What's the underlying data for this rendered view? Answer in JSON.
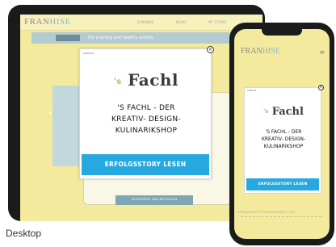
{
  "caption": "Desktop",
  "tablet": {
    "logo_a": "FRAN",
    "logo_b": "HISE",
    "menu": [
      "ERKUNDE",
      "NEWS",
      "MY STORE"
    ],
    "banner_text": "For a strong and healthy society.",
    "banner_right": "fit",
    "cta_label": "KOSTENFREI UND BESTELLEN"
  },
  "popup": {
    "tag": "ANZEIGE",
    "close_glyph": "×",
    "brand_prefix": "'s",
    "brand_name": "Fachl",
    "headline_line1": "'S FACHL - DER",
    "headline_line2": "KREATIV- DESIGN-",
    "headline_line3": "KULINARIKSHOP",
    "button_label": "ERFOLGSSTORY LESEN"
  },
  "phone": {
    "logo_a": "FRAN",
    "logo_b": "HISE",
    "menu_glyph": "≡",
    "note": "erfolgreichen Franchisesystem sind."
  },
  "colors": {
    "accent": "#27a9df",
    "site_bg": "#f3ea9e",
    "device": "#1b1b1b"
  },
  "icons": [
    "close-icon",
    "hamburger-menu-icon"
  ]
}
